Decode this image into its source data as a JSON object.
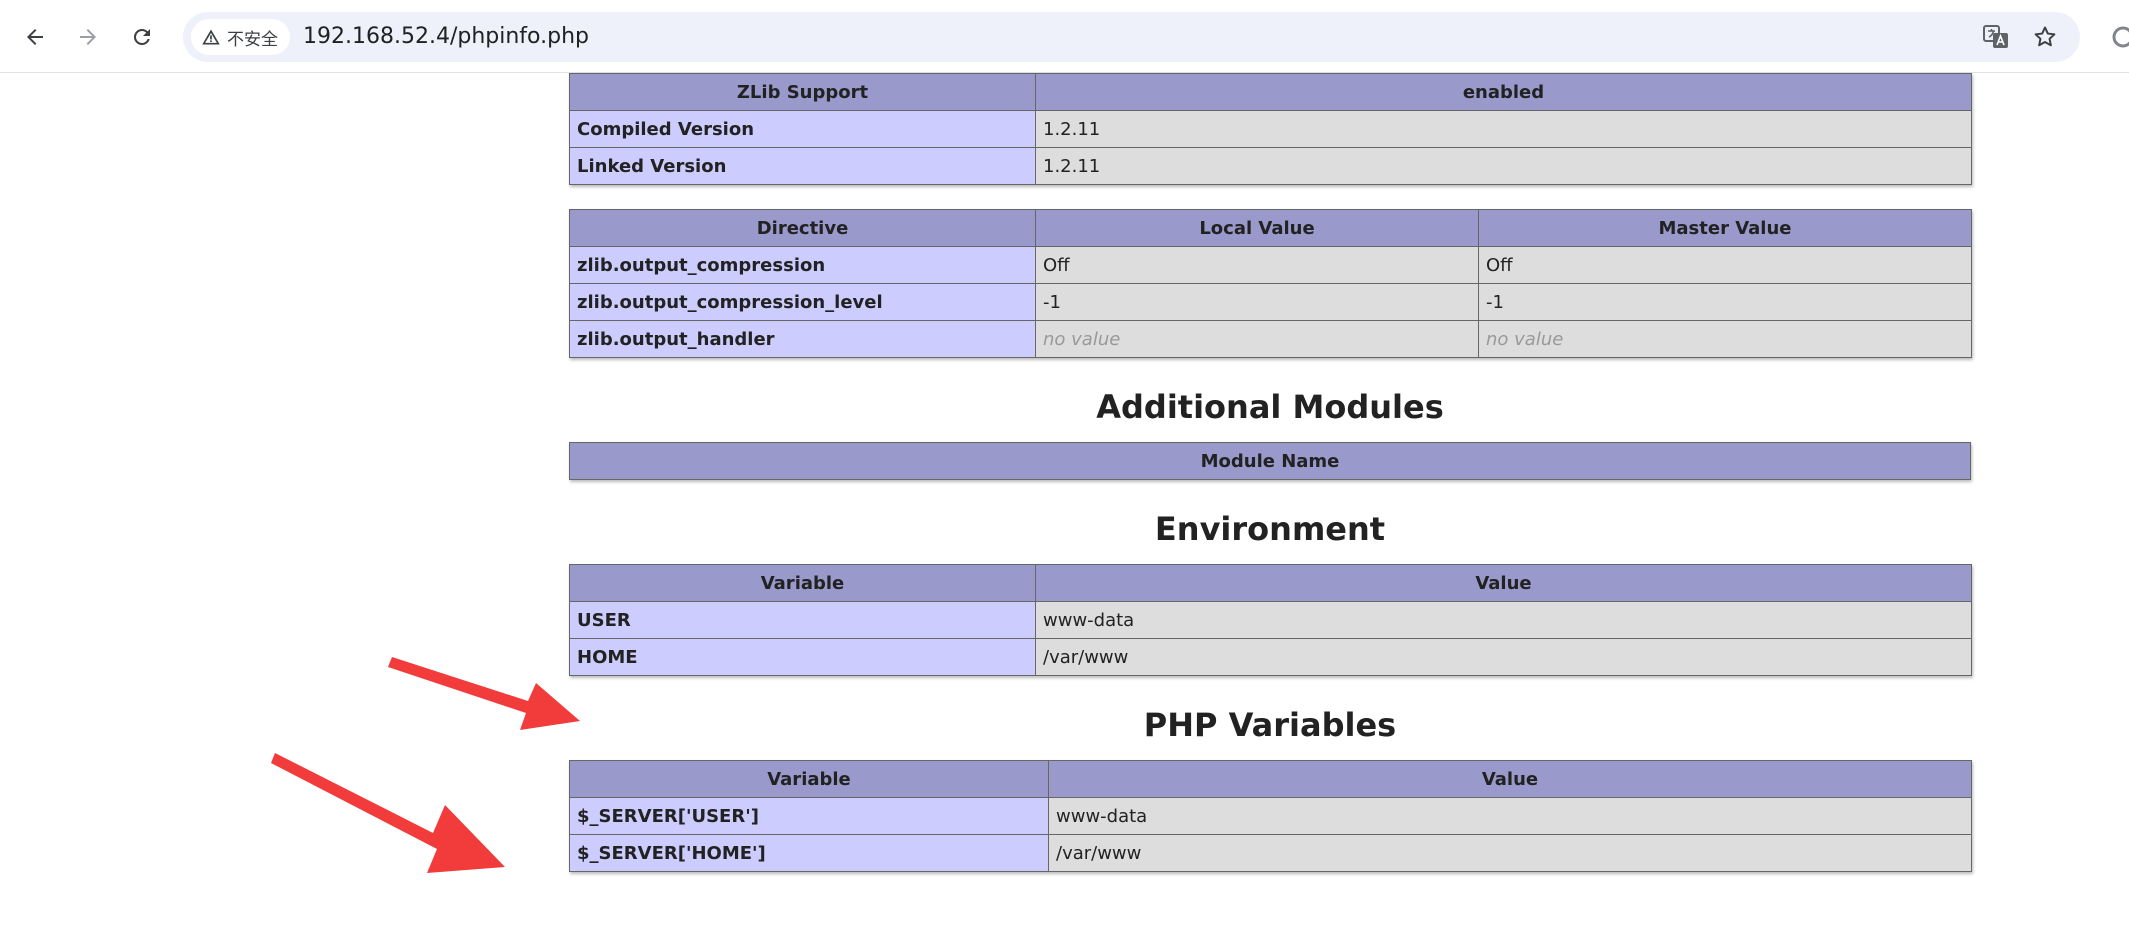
{
  "browser": {
    "security_chip": "不安全",
    "url": "192.168.52.4/phpinfo.php"
  },
  "zlib_table": {
    "header": [
      "ZLib Support",
      "enabled"
    ],
    "rows": [
      {
        "label": "Compiled Version",
        "value": "1.2.11"
      },
      {
        "label": "Linked Version",
        "value": "1.2.11"
      }
    ]
  },
  "zlib_directives": {
    "header": [
      "Directive",
      "Local Value",
      "Master Value"
    ],
    "rows": [
      {
        "directive": "zlib.output_compression",
        "local": "Off",
        "master": "Off"
      },
      {
        "directive": "zlib.output_compression_level",
        "local": "-1",
        "master": "-1"
      },
      {
        "directive": "zlib.output_handler",
        "local": "no value",
        "master": "no value"
      }
    ]
  },
  "additional_modules": {
    "title": "Additional Modules",
    "header": [
      "Module Name"
    ]
  },
  "environment": {
    "title": "Environment",
    "header": [
      "Variable",
      "Value"
    ],
    "rows": [
      {
        "variable": "USER",
        "value": "www-data"
      },
      {
        "variable": "HOME",
        "value": "/var/www"
      }
    ]
  },
  "php_variables": {
    "title": "PHP Variables",
    "header": [
      "Variable",
      "Value"
    ],
    "rows": [
      {
        "variable": "$_SERVER['USER']",
        "value": "www-data"
      },
      {
        "variable": "$_SERVER['HOME']",
        "value": "/var/www"
      }
    ]
  },
  "colors": {
    "header_bg": "#9999cc",
    "label_bg": "#ccccff",
    "value_bg": "#dddddd",
    "annotation_arrow": "#f23b3b"
  },
  "annotations": {
    "arrow_icons": [
      "red-arrow-icon",
      "red-arrow-icon"
    ]
  }
}
